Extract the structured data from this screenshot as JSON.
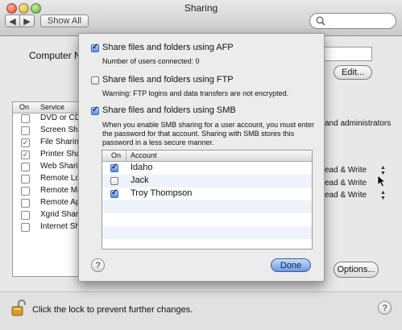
{
  "window": {
    "title": "Sharing"
  },
  "toolbar": {
    "back": "◀",
    "forward": "▶",
    "show_all": "Show All",
    "search_placeholder": ""
  },
  "main": {
    "computer_name_label": "Computer Na",
    "edit_label": "Edit...",
    "service_headers": {
      "on": "On",
      "service": "Service"
    },
    "services": [
      {
        "label": "DVD or CD",
        "on": false
      },
      {
        "label": "Screen Sha",
        "on": false
      },
      {
        "label": "File Sharing",
        "on": true
      },
      {
        "label": "Printer Sha",
        "on": true
      },
      {
        "label": "Web Sharing",
        "on": false
      },
      {
        "label": "Remote Lo",
        "on": false
      },
      {
        "label": "Remote Ma",
        "on": false
      },
      {
        "label": "Remote Ap",
        "on": false
      },
      {
        "label": "Xgrid Shari",
        "on": false
      },
      {
        "label": "Internet Sh",
        "on": false
      }
    ],
    "admin_text": "and administrators",
    "permissions": [
      "ead & Write",
      "ead & Write",
      "ead & Write"
    ],
    "options_label": "Options...",
    "lock_text": "Click the lock to prevent further changes.",
    "help_label": "?"
  },
  "sheet": {
    "afp": {
      "label": "Share files and folders using AFP",
      "checked": true,
      "info": "Number of users connected: 0"
    },
    "ftp": {
      "label": "Share files and folders using FTP",
      "checked": false,
      "info": "Warning: FTP logins and data transfers are not encrypted."
    },
    "smb": {
      "label": "Share files and folders using SMB",
      "checked": true,
      "info_lines": [
        "When you enable SMB sharing for a user account, you must enter",
        "the password for that account. Sharing with SMB stores this",
        "password in a less secure manner."
      ]
    },
    "accounts_headers": {
      "on": "On",
      "account": "Account"
    },
    "accounts": [
      {
        "name": "Idaho",
        "on": true
      },
      {
        "name": "Jack",
        "on": false
      },
      {
        "name": "Troy Thompson",
        "on": true
      }
    ],
    "help_label": "?",
    "done_label": "Done"
  },
  "colors": {
    "accent": "#5b8fd8",
    "done_button": "#6c9ae0"
  }
}
